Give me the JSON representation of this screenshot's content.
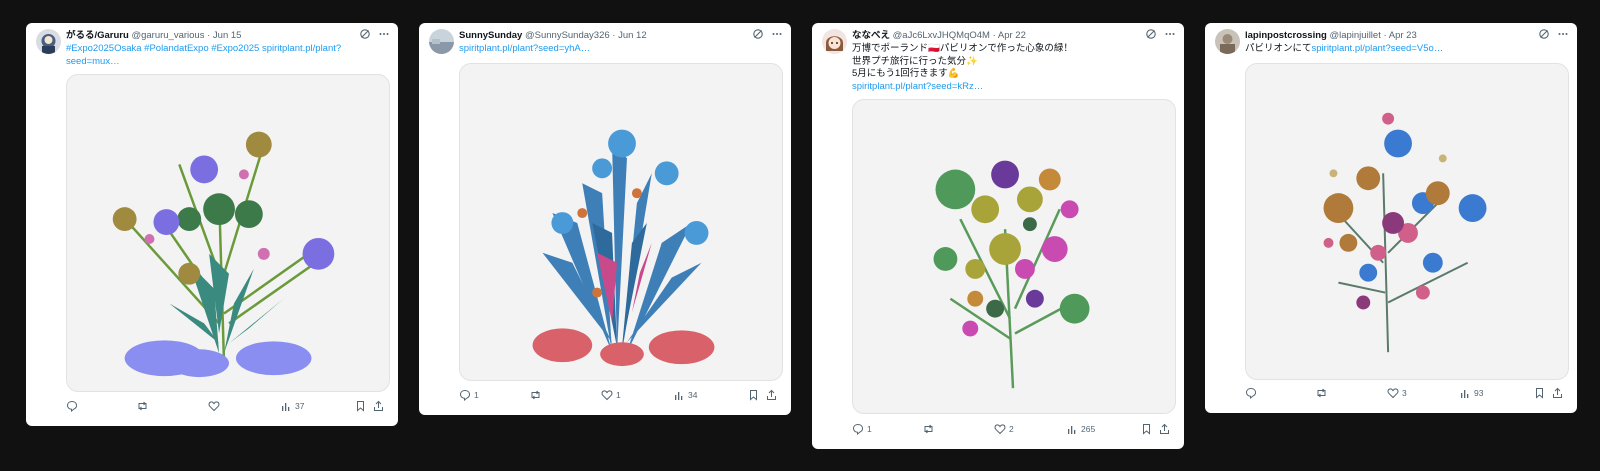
{
  "posts": [
    {
      "name": "がるる/Garuru",
      "handle": "@garuru_various",
      "date": "· Jun 15",
      "text_pre": "",
      "text_link": "#Expo2025Osaka #PolandatExpo #Expo2025 spiritplant.pl/plant?seed=mux…",
      "stats": {
        "replies": "",
        "reposts": "",
        "likes": "",
        "views": "37"
      },
      "avatar_icon": "avatar-photo-icon"
    },
    {
      "name": "SunnySunday",
      "handle": "@SunnySunday326",
      "date": "· Jun 12",
      "text_pre": "",
      "text_link": "spiritplant.pl/plant?seed=yhA…",
      "stats": {
        "replies": "1",
        "reposts": "",
        "likes": "1",
        "views": "34"
      },
      "avatar_icon": "avatar-photo-icon"
    },
    {
      "name": "ななべえ",
      "handle": "@aJc6LxvJHQMqO4M",
      "date": "· Apr 22",
      "lines": [
        "万博でポーランド🇵🇱パビリオンで作った心象の緑！",
        "世界プチ旅行に行った気分✨",
        "5月にもう1回行きます💪"
      ],
      "text_link": "spiritplant.pl/plant?seed=kRz…",
      "stats": {
        "replies": "1",
        "reposts": "",
        "likes": "2",
        "views": "265"
      },
      "avatar_icon": "avatar-anime-icon"
    },
    {
      "name": "lapinpostcrossing",
      "handle": "@lapinjuillet",
      "date": "· Apr 23",
      "text_pre": "パビリオンにて",
      "text_link": "spiritplant.pl/plant?seed=V5o…",
      "stats": {
        "replies": "",
        "reposts": "",
        "likes": "3",
        "views": "93"
      },
      "avatar_icon": "avatar-photo-icon"
    }
  ],
  "colors": {
    "link": "#1d9bf0",
    "text": "#0f1419",
    "muted": "#536471",
    "background": "#111111"
  }
}
